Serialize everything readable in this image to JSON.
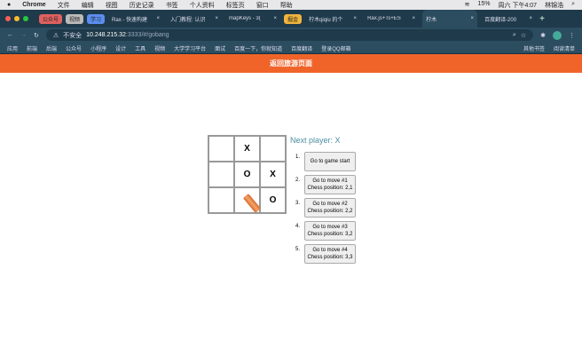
{
  "menubar": {
    "app": "Chrome",
    "items": [
      "文件",
      "编辑",
      "视图",
      "历史记录",
      "书签",
      "个人资料",
      "标签页",
      "窗口",
      "帮助"
    ],
    "battery": "15%",
    "datetime": "周六 下午4:07",
    "user": "林锦浩"
  },
  "tabs": [
    {
      "group": "公众号",
      "color": "#e06060"
    },
    {
      "group": "视频",
      "color": "#bbbbbb"
    },
    {
      "group": "学习",
      "color": "#5b8ef0"
    },
    {
      "label": "Rax - 快速构建"
    },
    {
      "label": "入门教程: 认识"
    },
    {
      "label": "mapKeys - 3("
    },
    {
      "group": "掘金",
      "color": "#f0b43c"
    },
    {
      "label": "柠木qiqiu 的个"
    },
    {
      "label": "Rax.js+Ts+ES"
    },
    {
      "label": "柠木",
      "active": true
    },
    {
      "label": "百度翻译-200"
    }
  ],
  "address": {
    "security": "不安全",
    "host": "10.248.215.32",
    "path": ":3333/#/gobang"
  },
  "bookmarks": [
    "应用",
    "前端",
    "后端",
    "公众号",
    "小程序",
    "设计",
    "工具",
    "视频",
    "大学学习平台",
    "面试",
    "百度一下，你就知道",
    "百度翻译",
    "登录QQ邮箱"
  ],
  "bookmarks_right": [
    "其他书签",
    "阅读清单"
  ],
  "banner": "返回旅游页面",
  "game": {
    "next_player": "Next player: X",
    "squares": [
      "",
      "X",
      "",
      "",
      "O",
      "X",
      "",
      "",
      "O"
    ],
    "moves": [
      {
        "n": "1.",
        "line1": "Go to game start",
        "line2": ""
      },
      {
        "n": "2.",
        "line1": "Go to move #1",
        "line2": "Chess position: 2,1"
      },
      {
        "n": "3.",
        "line1": "Go to move #2",
        "line2": "Chess position: 2,2"
      },
      {
        "n": "4.",
        "line1": "Go to move #3",
        "line2": "Chess position: 3,2"
      },
      {
        "n": "5.",
        "line1": "Go to move #4",
        "line2": "Chess position: 3,3"
      }
    ]
  }
}
